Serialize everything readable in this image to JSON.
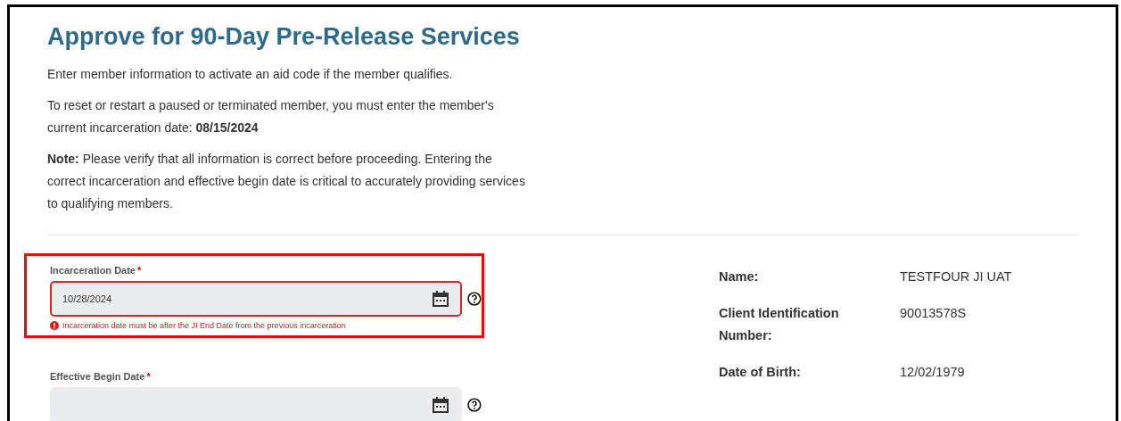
{
  "title": "Approve for 90-Day Pre-Release Services",
  "paragraphs": [
    "Enter member information to activate an aid code if the member qualifies.",
    "To reset or restart a paused or terminated member, you must enter the member's current incarceration date: **08/15/2024**",
    "**Note:** Please verify that all information is correct before proceeding. Entering the correct incarceration and effective begin date is critical to accurately providing services to qualifying members."
  ],
  "fields": [
    {
      "label": "Incarceration Date",
      "required_mark": "*",
      "value": "10/28/2024",
      "error": "Incarceration date must be after the JI End Date from the previous incarceration",
      "highlighted": true
    },
    {
      "label": "Effective Begin Date",
      "required_mark": "*",
      "highlighted": false
    }
  ],
  "member": [
    {
      "label": "Name:",
      "value": "TESTFOUR JI UAT"
    },
    {
      "label": "Client Identification Number:",
      "value": "90013578S"
    },
    {
      "label": "Date of Birth:",
      "value": "12/02/1979"
    }
  ]
}
